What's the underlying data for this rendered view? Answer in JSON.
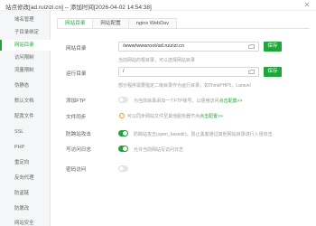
{
  "window": {
    "title": "站点修改[ad.ruizizi.cn] -- 添加时间[2026-04-02 14:54:38]"
  },
  "sidebar": {
    "items": [
      {
        "label": "域名管理"
      },
      {
        "label": "子目录绑定"
      },
      {
        "label": "网站目录"
      },
      {
        "label": "访问限制"
      },
      {
        "label": "流量限制"
      },
      {
        "label": "伪静态"
      },
      {
        "label": "默认文档"
      },
      {
        "label": "配置文件"
      },
      {
        "label": "SSL"
      },
      {
        "label": "PHP"
      },
      {
        "label": "重定向"
      },
      {
        "label": "反向代理"
      },
      {
        "label": "防盗链"
      },
      {
        "label": "防篡改"
      },
      {
        "label": "网站安全"
      }
    ],
    "active_index": 2
  },
  "tabs": [
    {
      "label": "网站目录"
    },
    {
      "label": "网站配置"
    },
    {
      "label": "nginx WebDav"
    }
  ],
  "form": {
    "site_dir": {
      "label": "网站目录",
      "value": "/www/wwwroot/ad.ruizizi.cn",
      "button": "保存",
      "hint": "当前网站的根目录，可以选择网站目录"
    },
    "run_dir": {
      "label": "运行目录",
      "value": "/",
      "button": "保存",
      "hint": "部分程序需要指定二级目录作为运行目录，如ThinkPHP5，Laravel"
    },
    "anti_xss": {
      "label": "防跨站攻击",
      "text": "防跨站攻击(open_basedir)，防止黑客通过其他网站目录进行入侵攻击",
      "on": true
    },
    "access_log": {
      "label": "写访问日志",
      "text": "允许当前网站写访问日志",
      "on": true
    },
    "password_access": {
      "label": "密码访问",
      "on": false
    },
    "ftp": {
      "label": "添加FTP",
      "text": "为当前目录添加一个FTP账号，以便用访问",
      "link": "点击配置>>",
      "on": false
    },
    "file_sync": {
      "label": "文件同步",
      "text": "可以同步网站文件至其他服务器节点",
      "link": "点击配置>>",
      "info_icon": "!"
    }
  },
  "colors": {
    "accent": "#20a53a",
    "warn": "#e89b2f"
  }
}
